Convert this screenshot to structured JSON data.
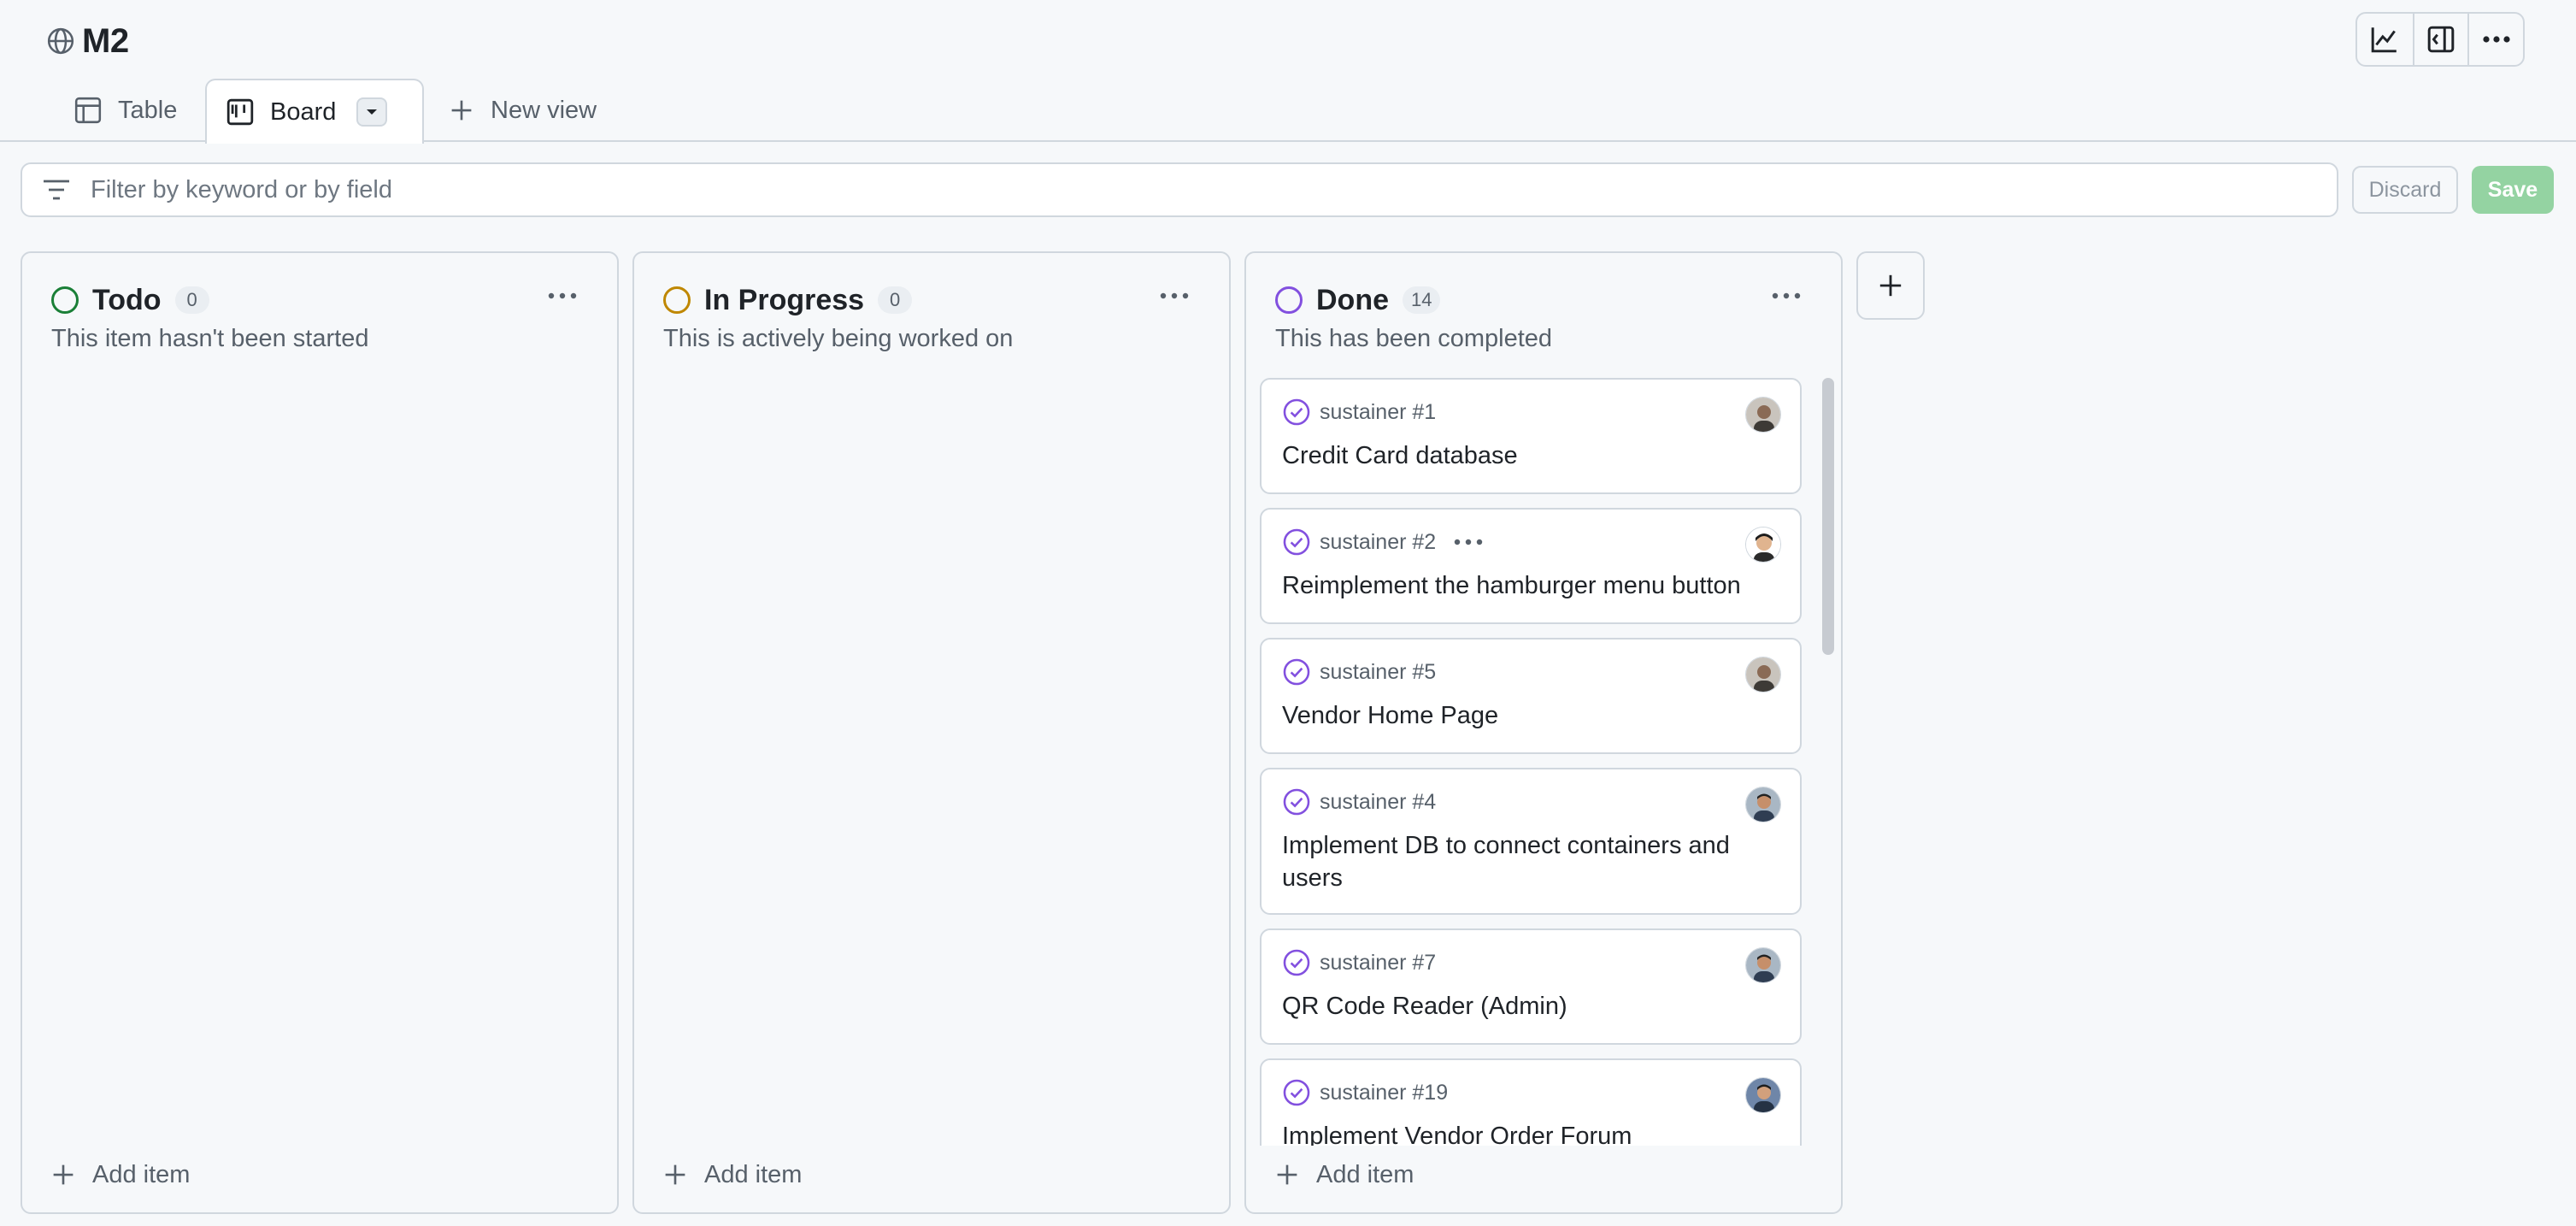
{
  "header": {
    "title": "M2"
  },
  "tabs": {
    "table": "Table",
    "board": "Board",
    "new_view": "New view"
  },
  "filter": {
    "placeholder": "Filter by keyword or by field"
  },
  "actions": {
    "discard": "Discard",
    "save": "Save"
  },
  "columns": [
    {
      "name": "Todo",
      "count": "0",
      "description": "This item hasn't been started",
      "add_label": "Add item",
      "color": "#1a7f37"
    },
    {
      "name": "In Progress",
      "count": "0",
      "description": "This is actively being worked on",
      "add_label": "Add item",
      "color": "#bf8700"
    },
    {
      "name": "Done",
      "count": "14",
      "description": "This has been completed",
      "add_label": "Add item",
      "color": "#8250df"
    }
  ],
  "cards": [
    {
      "ref": "sustainer #1",
      "title": "Credit Card database"
    },
    {
      "ref": "sustainer #2",
      "title": "Reimplement the hamburger menu button"
    },
    {
      "ref": "sustainer #5",
      "title": "Vendor Home Page"
    },
    {
      "ref": "sustainer #4",
      "title": "Implement DB to connect containers and users"
    },
    {
      "ref": "sustainer #7",
      "title": "QR Code Reader (Admin)"
    },
    {
      "ref": "sustainer #19",
      "title": "Implement Vendor Order Forum"
    }
  ],
  "icons": {
    "title": "globe-icon",
    "toolbar": [
      "insights-graph-icon",
      "side-panel-icon",
      "more-options-icon"
    ],
    "tabs": [
      "table-icon",
      "board-icon",
      "caret-down-icon",
      "plus-icon"
    ],
    "filter": "filter-icon",
    "card_status": "closed-issue-check-icon"
  }
}
